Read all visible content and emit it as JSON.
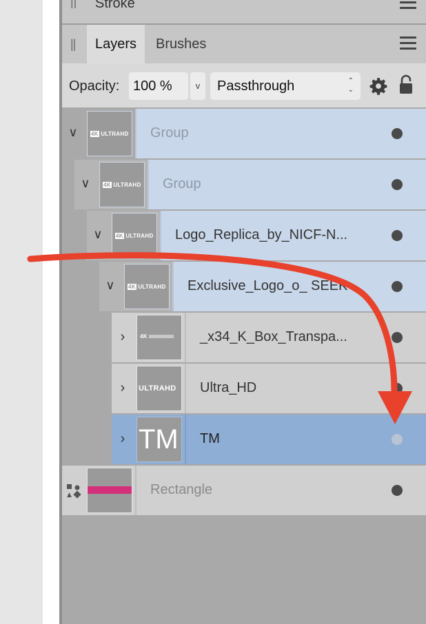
{
  "stroke_panel": {
    "title": "Stroke"
  },
  "tabs": [
    {
      "label": "Layers",
      "active": true
    },
    {
      "label": "Brushes",
      "active": false
    }
  ],
  "opacity": {
    "label": "Opacity:",
    "value": "100 %",
    "dropdown_glyph": "v"
  },
  "blend_mode": {
    "value": "Passthrough"
  },
  "layers": [
    {
      "name": "Group",
      "expanded": true,
      "visible": true,
      "dimmed": true,
      "thumb": "4k-ultrahd-logo"
    },
    {
      "name": "Group",
      "expanded": true,
      "visible": true,
      "dimmed": true,
      "thumb": "4k-ultrahd-logo"
    },
    {
      "name": "Logo_Replica_by_NICF-N...",
      "expanded": true,
      "visible": true,
      "dimmed": false,
      "thumb": "4k-ultrahd-logo"
    },
    {
      "name": "Exclusive_Logo_o_ SEEK",
      "expanded": true,
      "visible": true,
      "dimmed": false,
      "thumb": "4k-ultrahd-logo"
    },
    {
      "name": "_x34_K_Box_Transpa...",
      "expanded": false,
      "visible": true,
      "dimmed": false,
      "thumb": "4k-box"
    },
    {
      "name": "Ultra_HD",
      "expanded": false,
      "visible": true,
      "dimmed": false,
      "thumb": "ultrahd-text"
    },
    {
      "name": "TM",
      "expanded": false,
      "visible": false,
      "dimmed": false,
      "selected": true,
      "thumb": "tm-text"
    },
    {
      "name": "Rectangle",
      "expanded": null,
      "visible": true,
      "dimmed": true,
      "thumb": "pink-stripe"
    }
  ],
  "thumb_text": {
    "logo_4k": "4K",
    "logo_ultrahd": "ULTRAHD",
    "ultrahd_big": "ULTRAHD",
    "tm": "TM"
  },
  "colors": {
    "selected_row": "#8eaed6",
    "group_row": "#c9d7ea",
    "annotation_arrow": "#e8412c",
    "rectangle_stripe": "#d4307a"
  }
}
